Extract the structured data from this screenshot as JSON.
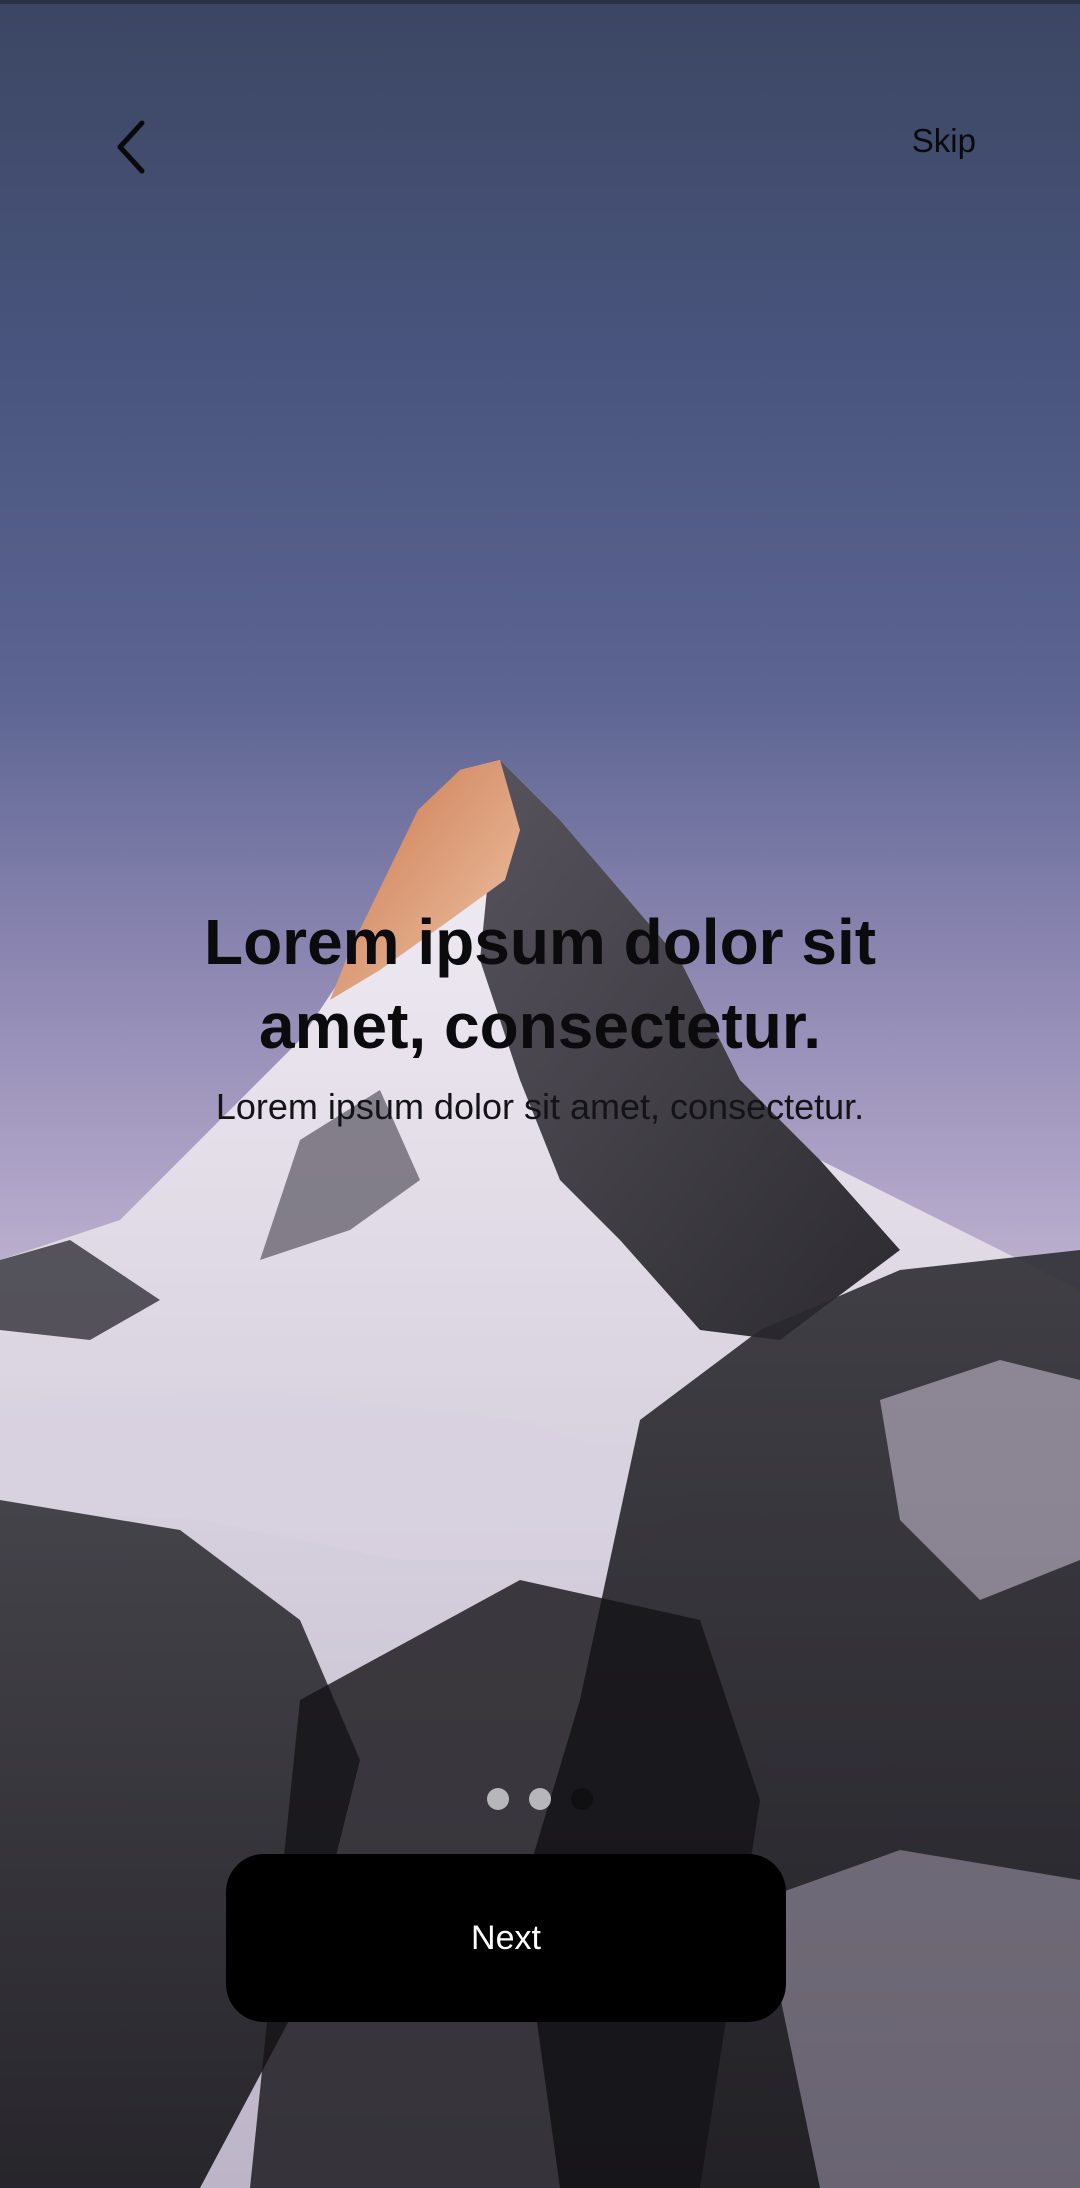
{
  "header": {
    "back_icon": "chevron-left-icon",
    "skip_label": "Skip"
  },
  "content": {
    "title": "Lorem ipsum dolor sit amet, consectetur.",
    "subtitle": "Lorem ipsum dolor sit amet, consectetur."
  },
  "pager": {
    "total": 3,
    "current": 3
  },
  "footer": {
    "next_label": "Next"
  },
  "colors": {
    "button_bg": "#000000",
    "button_text": "#ffffff",
    "dot_inactive": "#b7b6bb",
    "dot_active": "#101012"
  }
}
